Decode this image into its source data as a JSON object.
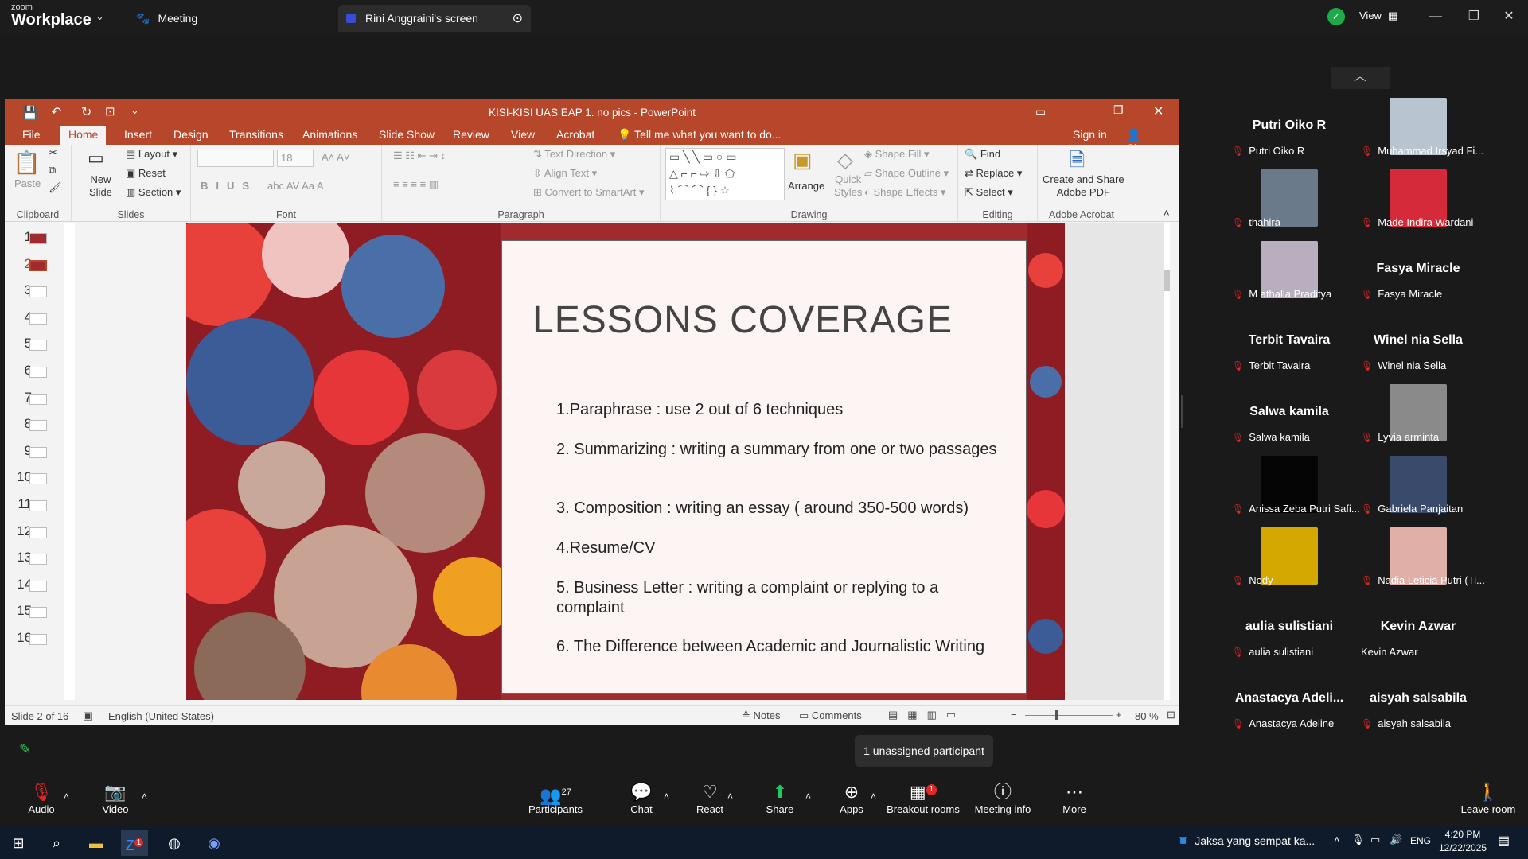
{
  "zoom": {
    "brand_small": "zoom",
    "brand": "Workplace",
    "tab_meeting": "Meeting",
    "tab_screen": "Rini Anggraini's screen",
    "view_label": "View"
  },
  "ppt": {
    "window_title": "KISI-KISI UAS EAP 1. no pics - PowerPoint",
    "signin": "Sign in",
    "share": "Share",
    "tabs": [
      "File",
      "Home",
      "Insert",
      "Design",
      "Transitions",
      "Animations",
      "Slide Show",
      "Review",
      "View",
      "Acrobat"
    ],
    "tellme": "Tell me what you want to do...",
    "clipboard": {
      "paste": "Paste",
      "label": "Clipboard"
    },
    "slides": {
      "new_slide": "New",
      "new_slide2": "Slide",
      "layout": "Layout",
      "reset": "Reset",
      "section": "Section",
      "label": "Slides"
    },
    "font": {
      "size": "18",
      "label": "Font"
    },
    "paragraph": {
      "text_direction": "Text Direction",
      "align_text": "Align Text",
      "smartart": "Convert to SmartArt",
      "label": "Paragraph"
    },
    "drawing": {
      "arrange": "Arrange",
      "quick_styles": "Quick",
      "quick_styles2": "Styles",
      "shape_fill": "Shape Fill",
      "shape_outline": "Shape Outline",
      "shape_effects": "Shape Effects",
      "label": "Drawing"
    },
    "editing": {
      "find": "Find",
      "replace": "Replace",
      "select": "Select",
      "label": "Editing"
    },
    "acrobat": {
      "create": "Create and Share",
      "create2": "Adobe PDF",
      "label": "Adobe Acrobat"
    },
    "thumb_numbers": [
      "1",
      "2",
      "3",
      "4",
      "5",
      "6",
      "7",
      "8",
      "9",
      "10",
      "11",
      "12",
      "13",
      "14",
      "15",
      "16"
    ],
    "slide": {
      "title": "LESSONS COVERAGE",
      "bullets": [
        "1.Paraphrase : use 2 out of 6 techniques",
        "2. Summarizing : writing a summary from one or two passages",
        "3. Composition : writing an essay ( around 350-500 words)",
        "4.Resume/CV",
        "5. Business Letter : writing a complaint or replying to a complaint",
        "6. The Difference between Academic and Journalistic Writing"
      ]
    },
    "status": {
      "slide_of": "Slide 2 of 16",
      "language": "English (United States)",
      "notes": "Notes",
      "comments": "Comments",
      "zoom": "80 %"
    }
  },
  "gallery": [
    {
      "name": "Putri Oiko R",
      "label": "Putri Oiko R",
      "muted": true
    },
    {
      "name": "",
      "label": "Muhammad Irsyad Fi...",
      "muted": true,
      "color": "#b8c4d0"
    },
    {
      "name": "",
      "label": "thahira",
      "muted": true,
      "color": "#6a7a8a"
    },
    {
      "name": "",
      "label": "Made Indira Wardani",
      "muted": true,
      "color": "#d42a3a"
    },
    {
      "name": "",
      "label": "M athalla Praditya",
      "muted": true,
      "color": "#b9aec0"
    },
    {
      "name": "Fasya Miracle",
      "label": "Fasya Miracle",
      "muted": true
    },
    {
      "name": "Terbit Tavaira",
      "label": "Terbit Tavaira",
      "muted": true
    },
    {
      "name": "Winel nia Sella",
      "label": "Winel nia Sella",
      "muted": true
    },
    {
      "name": "Salwa kamila",
      "label": "Salwa kamila",
      "muted": true
    },
    {
      "name": "",
      "label": "Lyvia arminta",
      "muted": true,
      "color": "#8a8a8a"
    },
    {
      "name": "",
      "label": "Anissa Zeba Putri Safi...",
      "muted": true,
      "color": "#050505"
    },
    {
      "name": "",
      "label": "Gabriela Panjaitan",
      "muted": true,
      "color": "#3a4a6a"
    },
    {
      "name": "",
      "label": "Nody",
      "muted": true,
      "color": "#d4a800"
    },
    {
      "name": "",
      "label": "Nadia Leticia Putri (Ti...",
      "muted": true,
      "color": "#e0b0a8"
    },
    {
      "name": "aulia sulistiani",
      "label": "aulia sulistiani",
      "muted": true
    },
    {
      "name": "Kevin Azwar",
      "label": "Kevin Azwar",
      "muted": false
    },
    {
      "name": "Anastacya Adeli...",
      "label": "Anastacya Adeline",
      "muted": true
    },
    {
      "name": "aisyah salsabila",
      "label": "aisyah salsabila",
      "muted": true
    }
  ],
  "unassigned": "1 unassigned participant",
  "toolbar": {
    "audio": "Audio",
    "video": "Video",
    "participants": "Participants",
    "participants_count": "27",
    "chat": "Chat",
    "react": "React",
    "share": "Share",
    "apps": "Apps",
    "breakout": "Breakout rooms",
    "breakout_badge": "1",
    "info": "Meeting info",
    "more": "More",
    "leave": "Leave room"
  },
  "taskbar": {
    "notification": "Jaksa yang sempat ka...",
    "lang": "ENG",
    "time": "4:20 PM",
    "date": "12/22/2025",
    "zoom_badge": "1"
  },
  "colors": {
    "ppt_accent": "#b7472a",
    "zoom_bg": "#1a1a1a",
    "mute_red": "#e02828",
    "share_green": "#22c55e"
  }
}
